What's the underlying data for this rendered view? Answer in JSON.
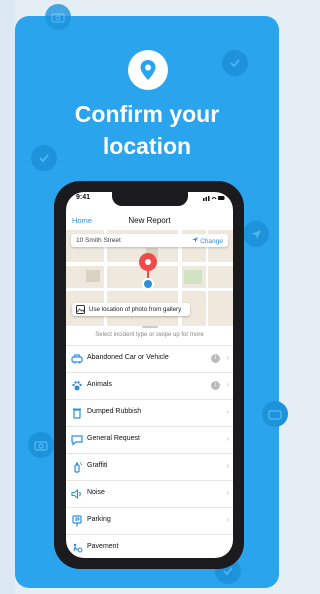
{
  "header": {
    "line1": "Confirm your",
    "line2": "location"
  },
  "phone": {
    "time": "9:41",
    "nav": {
      "back": "Home",
      "title": "New Report"
    },
    "map": {
      "address": "10 Smith Street",
      "change": "Change",
      "gallery": "Use location of photo from gallery"
    },
    "prompt": "Select incident type or swipe up for more",
    "categories": [
      {
        "label": "Abandoned Car or Vehicle",
        "icon": "car-icon",
        "info": true
      },
      {
        "label": "Animals",
        "icon": "paw-icon",
        "info": true
      },
      {
        "label": "Dumped Rubbish",
        "icon": "bin-icon",
        "info": false
      },
      {
        "label": "General Request",
        "icon": "chat-icon",
        "info": false
      },
      {
        "label": "Graffiti",
        "icon": "spray-icon",
        "info": false
      },
      {
        "label": "Noise",
        "icon": "speaker-icon",
        "info": false
      },
      {
        "label": "Parking",
        "icon": "parking-icon",
        "info": false
      },
      {
        "label": "Pavement",
        "icon": "pavement-icon",
        "info": false
      }
    ]
  },
  "colors": {
    "brand": "#2aa4ec",
    "accent": "#2a8fe0",
    "pin": "#f04a4a"
  }
}
